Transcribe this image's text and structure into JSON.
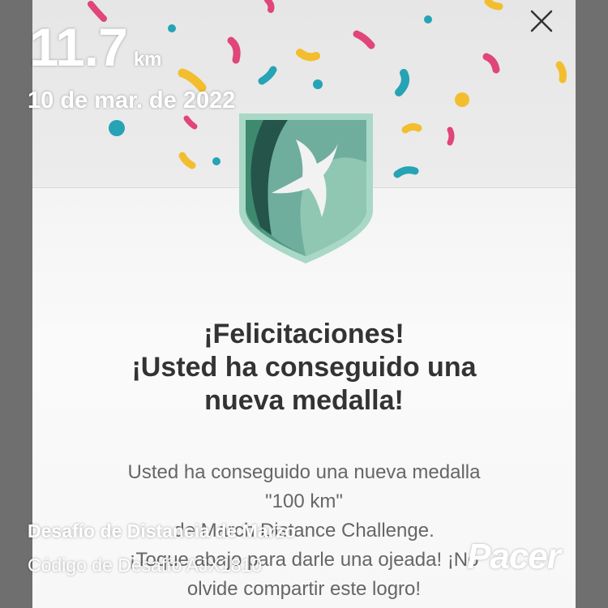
{
  "overlay": {
    "distance_value": "11.7",
    "distance_unit": "km",
    "date": "10 de mar. de 2022",
    "challenge_name": "Desafío de Distancia de Marzo",
    "challenge_code": "Código de Desafío AJX1810",
    "brand_logo": "Pacer"
  },
  "dialog": {
    "close_icon": "close-icon",
    "badge_icon": "swallow-shield-badge-icon",
    "title_lines": [
      "¡Felicitaciones!",
      "¡Usted ha conseguido una",
      "nueva medalla!"
    ],
    "body_lines": [
      "Usted ha conseguido una nueva medalla",
      "\"100 km\"",
      "de March Distance Challenge.",
      "¡Toque abajo para darle una ojeada! ¡No",
      "olvide compartir este logro!"
    ]
  },
  "colors": {
    "badge_dark": "#24544a",
    "badge_mid": "#4f9a86",
    "badge_light": "#a9d8c6",
    "confetti_pink": "#e0457b",
    "confetti_teal": "#26a3b5",
    "confetti_yellow": "#f3be2e"
  }
}
